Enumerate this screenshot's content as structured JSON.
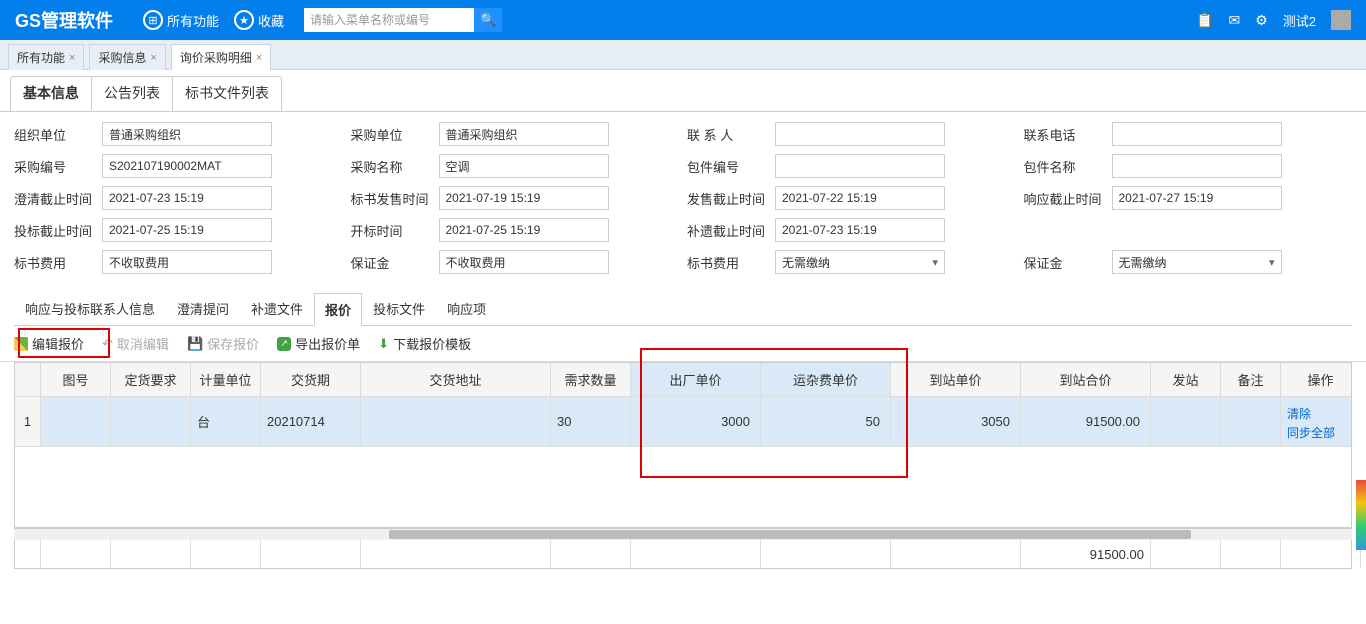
{
  "header": {
    "logo": "GS管理软件",
    "all_functions": "所有功能",
    "favorites": "收藏",
    "search_placeholder": "请输入菜单名称或编号",
    "user": "测试2"
  },
  "page_tabs": {
    "t1": "所有功能",
    "t2": "采购信息",
    "t3": "询价采购明细"
  },
  "sub_tabs": {
    "basic": "基本信息",
    "announce": "公告列表",
    "bidfile": "标书文件列表"
  },
  "form": {
    "org_unit_label": "组织单位",
    "org_unit": "普通采购组织",
    "purchase_unit_label": "采购单位",
    "purchase_unit": "普通采购组织",
    "contact_label": "联 系 人",
    "contact": "",
    "phone_label": "联系电话",
    "phone": "",
    "purchase_no_label": "采购编号",
    "purchase_no": "S202107190002MAT",
    "purchase_name_label": "采购名称",
    "purchase_name": "空调",
    "package_no_label": "包件编号",
    "package_no": "",
    "package_name_label": "包件名称",
    "package_name": "",
    "clarify_deadline_label": "澄清截止时间",
    "clarify_deadline": "2021-07-23 15:19",
    "bid_sale_time_label": "标书发售时间",
    "bid_sale_time": "2021-07-19 15:19",
    "sale_deadline_label": "发售截止时间",
    "sale_deadline": "2021-07-22 15:19",
    "response_deadline_label": "响应截止时间",
    "response_deadline": "2021-07-27 15:19",
    "bid_deadline_label": "投标截止时间",
    "bid_deadline": "2021-07-25 15:19",
    "open_time_label": "开标时间",
    "open_time": "2021-07-25 15:19",
    "supplement_deadline_label": "补遗截止时间",
    "supplement_deadline": "2021-07-23 15:19",
    "bid_fee_label": "标书费用",
    "bid_fee": "不收取费用",
    "deposit_label": "保证金",
    "deposit": "不收取费用",
    "bid_fee2_label": "标书费用",
    "bid_fee2": "无需缴纳",
    "deposit2_label": "保证金",
    "deposit2": "无需缴纳"
  },
  "detail_tabs": {
    "contact": "响应与投标联系人信息",
    "clarify": "澄清提问",
    "supplement": "补遗文件",
    "quote": "报价",
    "bidfile": "投标文件",
    "response": "响应项"
  },
  "toolbar": {
    "edit": "编辑报价",
    "cancel": "取消编辑",
    "save": "保存报价",
    "export": "导出报价单",
    "download": "下载报价模板"
  },
  "grid": {
    "headers": {
      "row": "",
      "drawing": "图号",
      "order_req": "定货要求",
      "unit": "计量单位",
      "delivery": "交货期",
      "address": "交货地址",
      "qty": "需求数量",
      "factory_price": "出厂单价",
      "misc_price": "运杂费单价",
      "arrive_price": "到站单价",
      "arrive_total": "到站合价",
      "station": "发站",
      "remark": "备注",
      "ops": "操作"
    },
    "row1": {
      "idx": "1",
      "drawing": "",
      "order_req": "",
      "unit": "台",
      "delivery": "20210714",
      "address": "",
      "qty": "30",
      "factory_price": "3000",
      "misc_price": "50",
      "arrive_price": "3050",
      "arrive_total": "91500.00",
      "station": "",
      "remark": ""
    },
    "ops": {
      "clear": "清除",
      "sync": "同步全部"
    },
    "footer_total": "91500.00"
  }
}
